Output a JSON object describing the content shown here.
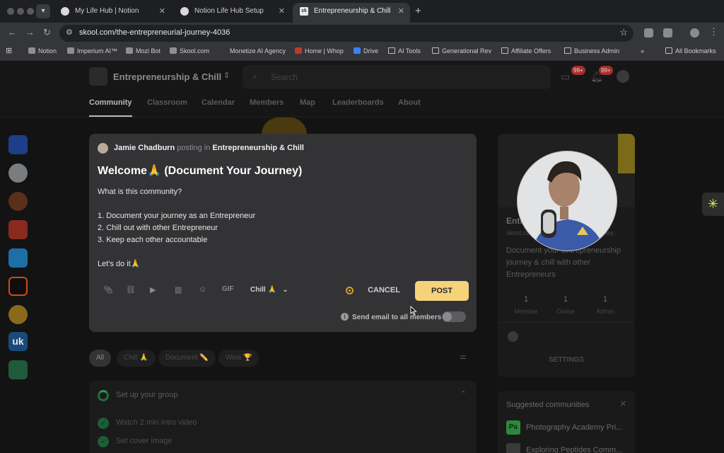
{
  "browser": {
    "tabs": [
      {
        "title": "My Life Hub | Notion",
        "active": false
      },
      {
        "title": "Notion Life Hub Setup",
        "active": false
      },
      {
        "title": "Entrepreneurship & Chill",
        "active": true
      }
    ],
    "url": "skool.com/the-entrepreneurial-journey-4036",
    "bookmarks": [
      "Notion",
      "Imperium AI™",
      "Mozi Bot",
      "Skool.com",
      "Monetize AI Agency",
      "Home | Whop",
      "Drive",
      "AI Tools",
      "Generational Rev",
      "Affiliate Offers",
      "Business Admin"
    ],
    "all_bookmarks_label": "All Bookmarks",
    "more_label": "»"
  },
  "header": {
    "group_name": "Entrepreneurship & Chill",
    "search_placeholder": "Search",
    "chat_badge": "99+",
    "notif_badge": "99+",
    "nav_tabs": [
      "Community",
      "Classroom",
      "Calendar",
      "Members",
      "Map",
      "Leaderboards",
      "About"
    ],
    "active_tab": "Community"
  },
  "composer": {
    "author": "Jamie Chadburn",
    "posting_in_text": "posting in",
    "group": "Entrepreneurship & Chill",
    "title": "Welcome🙏 (Document Your Journey)",
    "body_lines": [
      "What is this community?",
      "",
      "1. Document your journey as an Entrepreneur",
      "2. Chill out with other Entrepreneur",
      "3. Keep each other accountable",
      "",
      "Let's do it🙏"
    ],
    "gif_label": "GIF",
    "category": "Chill 🙏",
    "cancel_label": "CANCEL",
    "post_label": "POST",
    "email_label": "Send email to all members",
    "email_toggle_on": false
  },
  "filters": {
    "pills": [
      "All",
      "Chill 🙏",
      "Document ✏️",
      "Wins 🏆"
    ],
    "active": "All"
  },
  "setup": {
    "title": "Set up your group",
    "items": [
      "Watch 2 min intro video",
      "Set cover image"
    ]
  },
  "sidebar": {
    "title": "Entrepreneurship & Chill",
    "url": "skool.com/the-entrepreneurial-journey...",
    "description": "Document your Entrepreneurship journey & chill with other Entrepreneurs",
    "stats": [
      {
        "value": "1",
        "label": "Member"
      },
      {
        "value": "1",
        "label": "Online"
      },
      {
        "value": "1",
        "label": "Admin"
      }
    ],
    "settings_label": "SETTINGS"
  },
  "suggested": {
    "title": "Suggested communities",
    "items": [
      {
        "logo": "Pa",
        "name": "Photography Academy Pri..."
      },
      {
        "logo": "",
        "name": "Exploring Peptides Comm..."
      }
    ]
  },
  "left_rail": {
    "uk_label": "uk"
  },
  "colors": {
    "accent_post": "#f5d37a",
    "progress_green": "#2e9a52",
    "badge_red": "#a3302a"
  }
}
